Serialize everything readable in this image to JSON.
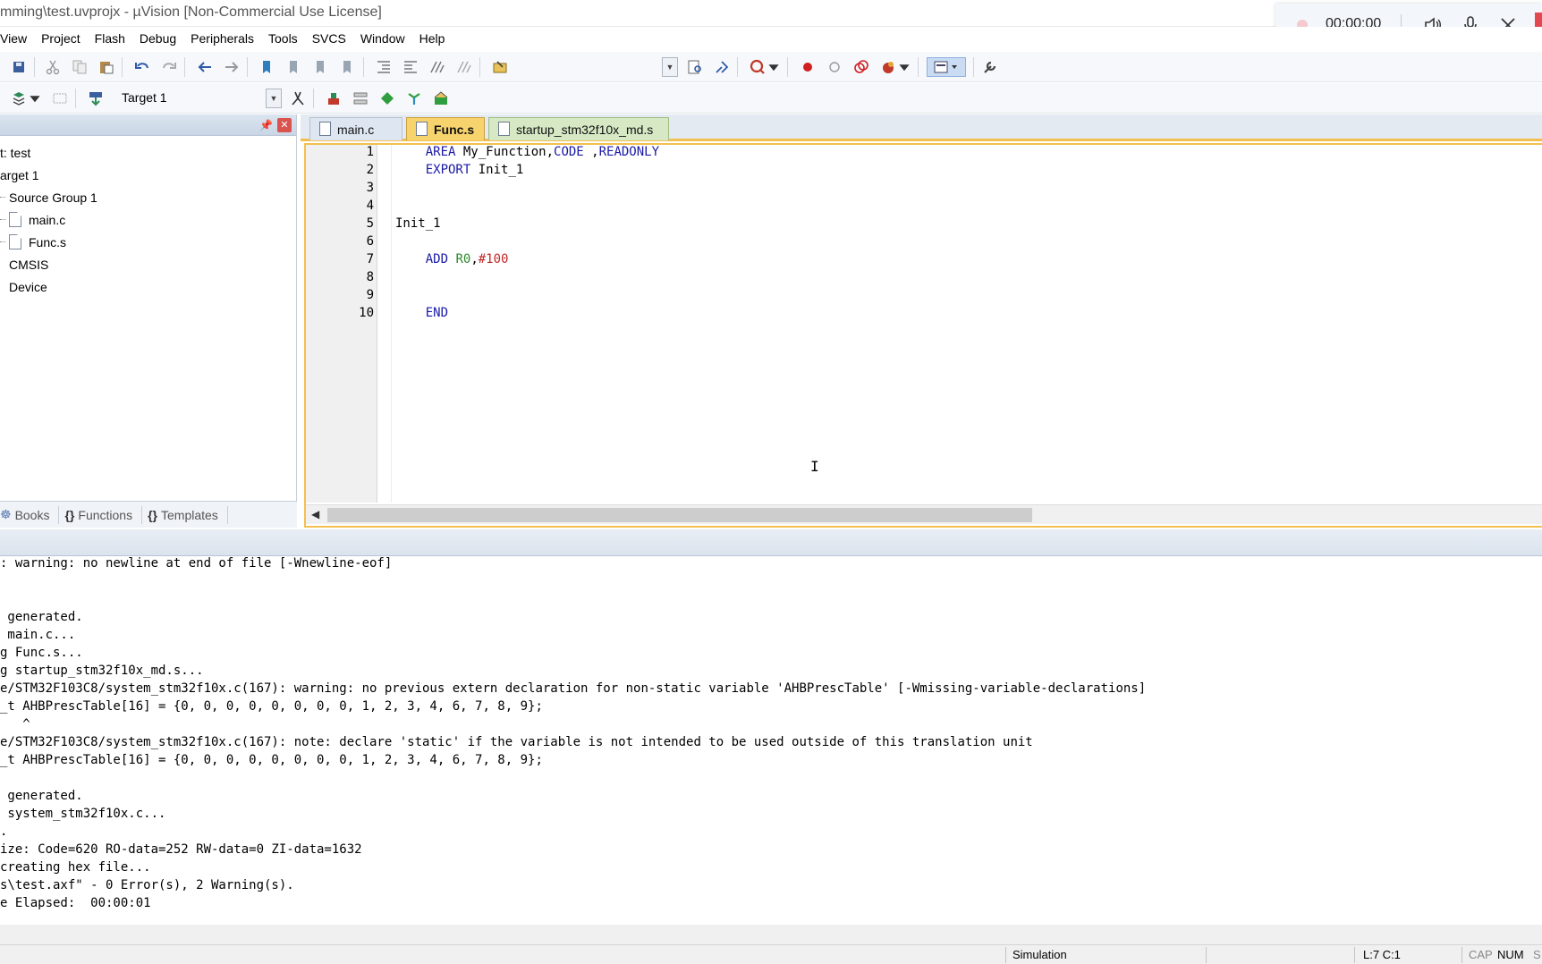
{
  "window": {
    "title": "mming\\test.uvprojx - µVision  [Non-Commercial Use License]"
  },
  "recorder": {
    "time": "00:00:00"
  },
  "menu": [
    "View",
    "Project",
    "Flash",
    "Debug",
    "Peripherals",
    "Tools",
    "SVCS",
    "Window",
    "Help"
  ],
  "toolbar2": {
    "target": "Target 1"
  },
  "project": {
    "tree": [
      {
        "label": "t: test"
      },
      {
        "label": "arget 1"
      },
      {
        "label": "Source Group 1"
      },
      {
        "label": "main.c"
      },
      {
        "label": "Func.s"
      },
      {
        "label": "CMSIS"
      },
      {
        "label": "Device"
      }
    ],
    "tabs": [
      "Books",
      "Functions",
      "Templates"
    ]
  },
  "editor": {
    "tabs": [
      "main.c",
      "Func.s",
      "startup_stm32f10x_md.s"
    ],
    "lines": [
      {
        "n": "1",
        "parts": [
          [
            "",
            "    "
          ],
          [
            "kw",
            "AREA"
          ],
          [
            "",
            " My_Function,"
          ],
          [
            "kw",
            "CODE"
          ],
          [
            "",
            " ,"
          ],
          [
            "kw",
            "READONLY"
          ]
        ]
      },
      {
        "n": "2",
        "parts": [
          [
            "",
            "    "
          ],
          [
            "kw",
            "EXPORT"
          ],
          [
            "",
            " Init_1"
          ]
        ]
      },
      {
        "n": "3",
        "parts": []
      },
      {
        "n": "4",
        "parts": []
      },
      {
        "n": "5",
        "parts": [
          [
            "",
            "Init_1"
          ]
        ]
      },
      {
        "n": "6",
        "parts": []
      },
      {
        "n": "7",
        "parts": [
          [
            "",
            "    "
          ],
          [
            "kw",
            "ADD"
          ],
          [
            "",
            " "
          ],
          [
            "reg",
            "R0"
          ],
          [
            "",
            ","
          ],
          [
            "imm",
            "#100"
          ]
        ]
      },
      {
        "n": "8",
        "parts": []
      },
      {
        "n": "9",
        "parts": []
      },
      {
        "n": "10",
        "parts": [
          [
            "",
            "    "
          ],
          [
            "kw",
            "END"
          ]
        ]
      }
    ]
  },
  "output": {
    "lines": [
      ": warning: no newline at end of file [-Wnewline-eof]",
      "",
      "",
      " generated.",
      " main.c...",
      "g Func.s...",
      "g startup_stm32f10x_md.s...",
      "e/STM32F103C8/system_stm32f10x.c(167): warning: no previous extern declaration for non-static variable 'AHBPrescTable' [-Wmissing-variable-declarations]",
      "_t AHBPrescTable[16] = {0, 0, 0, 0, 0, 0, 0, 0, 1, 2, 3, 4, 6, 7, 8, 9};",
      "   ^",
      "e/STM32F103C8/system_stm32f10x.c(167): note: declare 'static' if the variable is not intended to be used outside of this translation unit",
      "_t AHBPrescTable[16] = {0, 0, 0, 0, 0, 0, 0, 0, 1, 2, 3, 4, 6, 7, 8, 9};",
      "",
      " generated.",
      " system_stm32f10x.c...",
      ".",
      "ize: Code=620 RO-data=252 RW-data=0 ZI-data=1632",
      "creating hex file...",
      "s\\test.axf\" - 0 Error(s), 2 Warning(s).",
      "e Elapsed:  00:00:01"
    ]
  },
  "status": {
    "mode": "Simulation",
    "position": "L:7 C:1",
    "cap": "CAP",
    "num": "NUM",
    "scrl": "S"
  },
  "colors": {
    "keyword": "#1a1aa6",
    "register": "#2d8a2d",
    "immediate": "#c02828",
    "active_tab": "#f7d36e"
  }
}
